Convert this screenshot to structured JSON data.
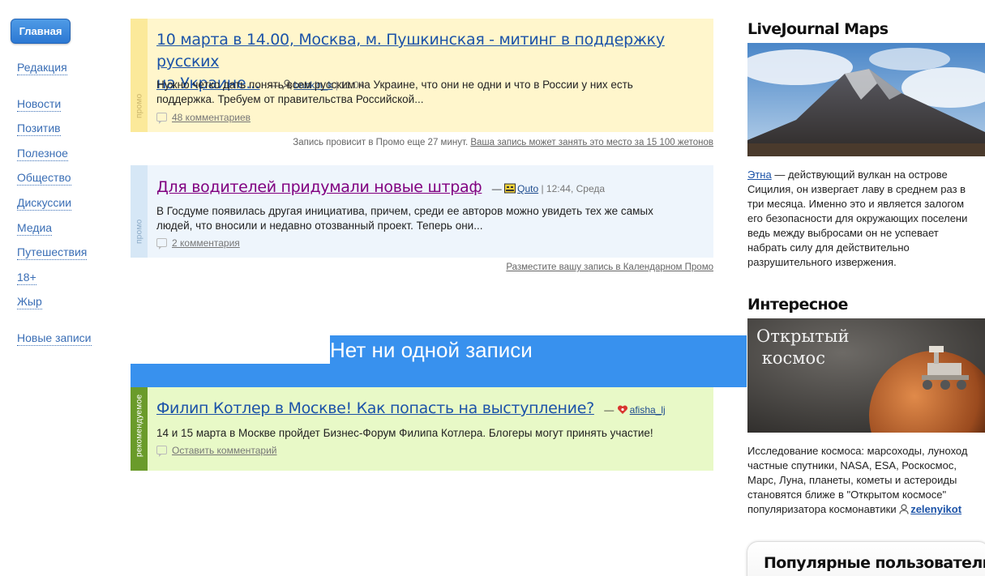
{
  "nav": {
    "main": "Главная",
    "items": [
      "Редакция",
      "Новости",
      "Позитив",
      "Полезное",
      "Общество",
      "Дискуссии",
      "Медиа",
      "Путешествия",
      "18+",
      "Жыр",
      "Новые записи"
    ]
  },
  "posts": [
    {
      "band_label": "промо",
      "title_line1": "10 марта в 14.00, Москва, м. Пушкинская - митинг в поддержку русских",
      "title_line2": "на Украине...",
      "dash": "—",
      "user": "babkin_k",
      "time": "| 11:04",
      "excerpt_line1": "Нужно четко дать понять всем русским на Украине, что они не одни и что в России у них есть",
      "excerpt_line2": "поддержка. Требуем от правительства Российской...",
      "comments": "48 комментариев"
    },
    {
      "band_label": "промо",
      "title": "Для водителей придумали новые штраф",
      "dash": "—",
      "user": "Quto",
      "time": "| 12:44, Среда",
      "excerpt_line1": "В Госдуме появилась другая инициатива, причем, среди ее авторов можно увидеть тех же самых",
      "excerpt_line2": "людей, что вносили и недавно отозванный проект. Теперь они...",
      "comments": "2 комментария"
    },
    {
      "band_label": "рекомендуемое",
      "title": "Филип Котлер в Москве! Как попасть на выступление?",
      "dash": "—",
      "user": "afisha_lj",
      "excerpt_line1": "14 и 15 марта в Москве пройдет Бизнес-Форум Филипа Котлера. Блогеры могут принять участие!",
      "comments": "Оставить комментарий"
    }
  ],
  "promo_note1": {
    "text": "Запись провисит в Промо еще 27 минут.",
    "link": "Ваша запись может занять это место за 15 100 жетонов"
  },
  "promo_note2": {
    "link": "Разместите вашу запись в Календарном Промо"
  },
  "overlay": {
    "text": "Нет ни одной записи"
  },
  "sidebar": {
    "maps_title": "LiveJournal Maps",
    "maps_link": "Этна",
    "maps_lines": [
      " — действующий вулкан на острове",
      "Сицилия, он извергает лаву в среднем раз в",
      "три месяца. Именно это и является залогом",
      "его безопасности для окружающих поселени",
      "ведь между выбросами он не успевает",
      "набрать силу для действительно",
      "разрушительного извержения."
    ],
    "interesting_title": "Интересное",
    "space_image_text_line1": "Открытый",
    "space_image_text_line2": "космос",
    "interesting_lines": [
      "Исследование космоса: марсоходы, луноход",
      "частные спутники, NASA, ESA, Роскосмос,",
      "Марс, Луна, планеты, кометы и астероиды",
      "становятся ближе в \"Открытом космосе\"",
      "популяризатора космонавтики "
    ],
    "interesting_user": "zelenyikot",
    "popular_title": "Популярные пользователи"
  },
  "colors": {
    "accent": "#3891ee",
    "link": "#1c53a8",
    "visited": "#800080"
  }
}
